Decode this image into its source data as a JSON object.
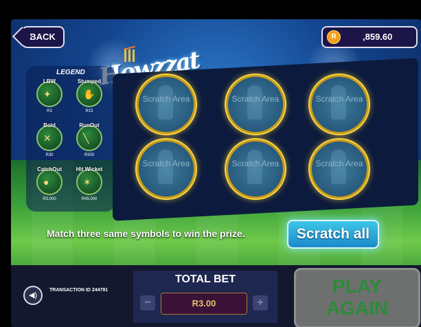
{
  "top": {
    "back_label": "BACK",
    "balance": {
      "currency_symbol": "R",
      "amount": ",859.60"
    }
  },
  "logo": {
    "text": "Howzzat"
  },
  "legend": {
    "title": "LEGEND",
    "items": [
      {
        "name": "LBW",
        "prize": "R3"
      },
      {
        "name": "Stumped",
        "prize": "R15"
      },
      {
        "name": "Bold",
        "prize": "R30"
      },
      {
        "name": "RunOut",
        "prize": "R300"
      },
      {
        "name": "CatchOut",
        "prize": "R3,000"
      },
      {
        "name": "Hit Wicket",
        "prize": "R45,000"
      }
    ]
  },
  "scratch_spots": [
    {
      "label": "Scratch Area"
    },
    {
      "label": "Scratch Area"
    },
    {
      "label": "Scratch Area"
    },
    {
      "label": "Scratch Area"
    },
    {
      "label": "Scratch Area"
    },
    {
      "label": "Scratch Area"
    }
  ],
  "instructions": "Match three same symbols to win the prize.",
  "scratch_all_label": "Scratch all",
  "bottom": {
    "transaction": "TRANSACTION ID 244791",
    "bet_title": "TOTAL BET",
    "bet_value": "R3.00",
    "minus": "−",
    "plus": "+",
    "play_again": [
      "PLAY",
      "AGAIN"
    ]
  },
  "icons": {
    "sound": "speaker-icon",
    "coin": "coin-icon"
  },
  "colors": {
    "accent_gold": "#f4d44a",
    "scratch_all": "#3ec6e8",
    "play_again_text": "#2d8a3a"
  }
}
